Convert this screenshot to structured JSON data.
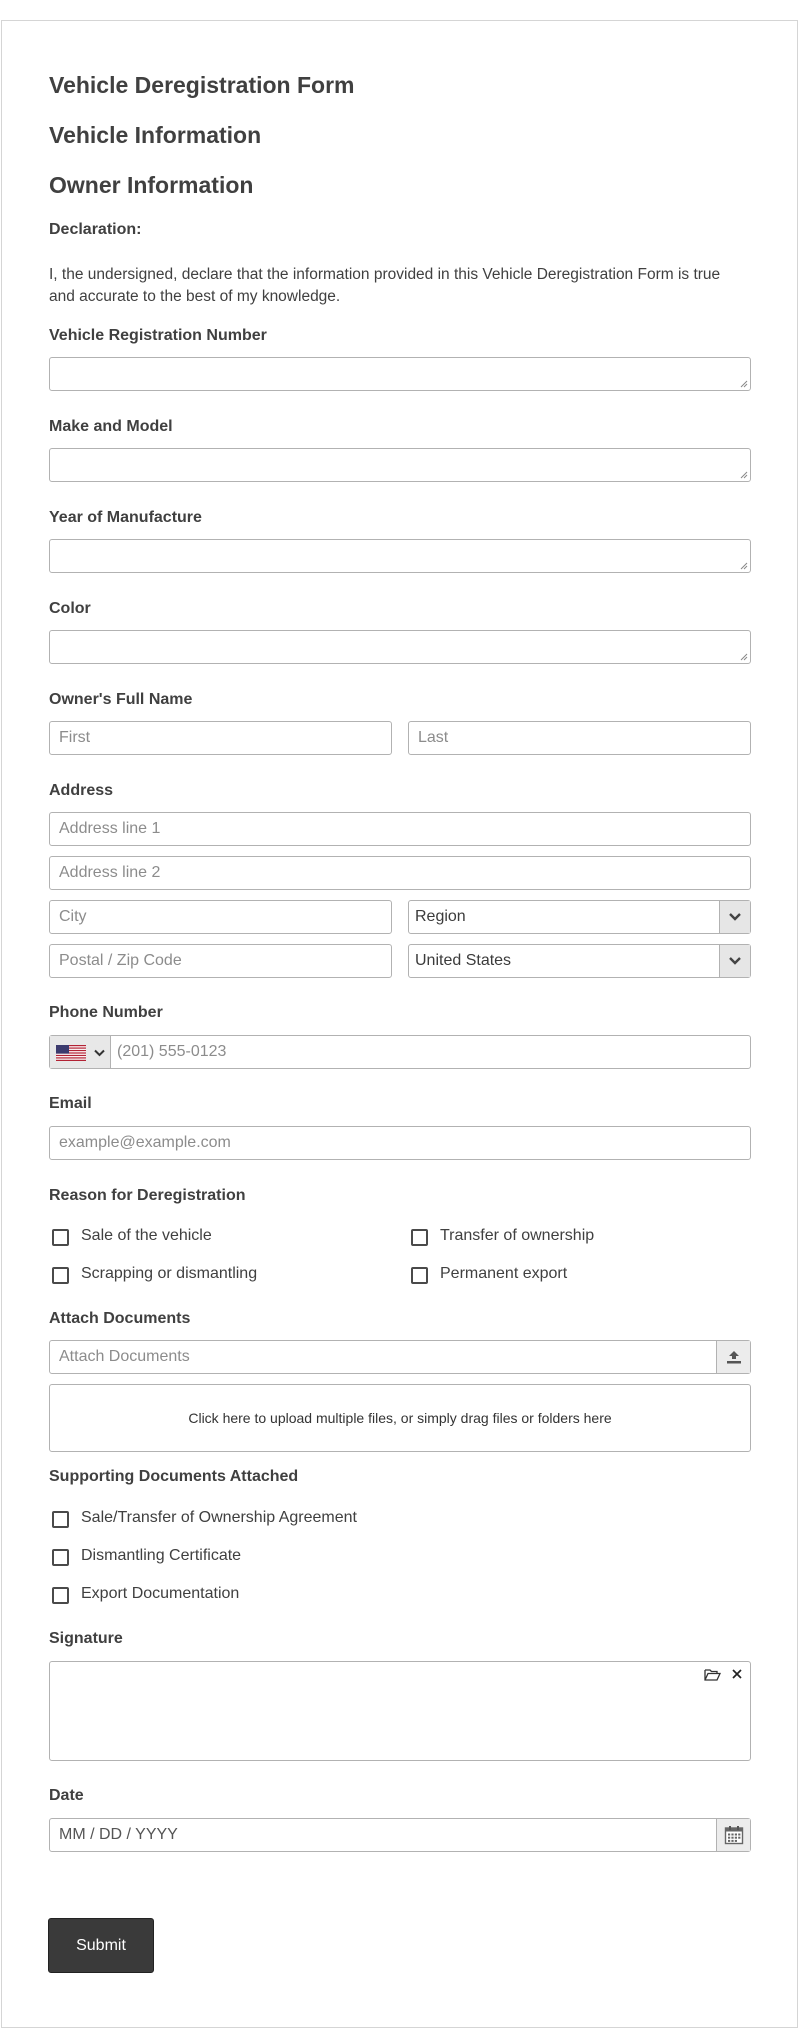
{
  "form": {
    "title": "Vehicle Deregistration Form",
    "section_vehicle": "Vehicle Information",
    "section_owner": "Owner Information",
    "declaration_label": "Declaration:",
    "declaration_text": "I, the undersigned, declare that the information provided in this Vehicle Deregistration Form is true and accurate to the best of my knowledge."
  },
  "vehicle": {
    "registration_label": "Vehicle Registration Number",
    "make_model_label": "Make and Model",
    "year_label": "Year of Manufacture",
    "color_label": "Color"
  },
  "owner": {
    "name_label": "Owner's Full Name",
    "first_placeholder": "First",
    "last_placeholder": "Last"
  },
  "address": {
    "label": "Address",
    "line1_placeholder": "Address line 1",
    "line2_placeholder": "Address line 2",
    "city_placeholder": "City",
    "region_value": "Region",
    "postal_placeholder": "Postal / Zip Code",
    "country_value": "United States"
  },
  "phone": {
    "label": "Phone Number",
    "placeholder": "(201) 555-0123",
    "flag_icon": "us-flag-icon"
  },
  "email": {
    "label": "Email",
    "placeholder": "example@example.com"
  },
  "reason": {
    "label": "Reason for Deregistration",
    "options": [
      "Sale of the vehicle",
      "Transfer of ownership",
      "Scrapping or dismantling",
      "Permanent export"
    ]
  },
  "attachments": {
    "label": "Attach Documents",
    "placeholder": "Attach Documents",
    "dropzone_text": "Click here to upload multiple files, or simply drag files or folders here"
  },
  "supporting": {
    "label": "Supporting Documents Attached",
    "options": [
      "Sale/Transfer of Ownership Agreement",
      "Dismantling Certificate",
      "Export Documentation"
    ]
  },
  "signature": {
    "label": "Signature"
  },
  "date": {
    "label": "Date",
    "placeholder": "MM / DD / YYYY"
  },
  "submit_label": "Submit"
}
